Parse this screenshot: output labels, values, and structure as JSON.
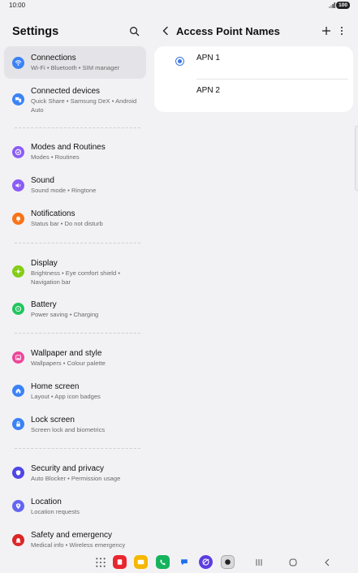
{
  "status_bar": {
    "time": "10:00",
    "battery": "100"
  },
  "left_panel": {
    "title": "Settings",
    "items": [
      {
        "title": "Connections",
        "subtitle": "Wi-Fi  •  Bluetooth  •  SIM manager",
        "icon": "wifi-icon",
        "color": "#3b82f6"
      },
      {
        "title": "Connected devices",
        "subtitle": "Quick Share  •  Samsung DeX  •  Android Auto",
        "icon": "devices-icon",
        "color": "#3b82f6"
      },
      {
        "title": "Modes and Routines",
        "subtitle": "Modes  •  Routines",
        "icon": "routines-icon",
        "color": "#8b5cf6"
      },
      {
        "title": "Sound",
        "subtitle": "Sound mode  •  Ringtone",
        "icon": "speaker-icon",
        "color": "#8b5cf6"
      },
      {
        "title": "Notifications",
        "subtitle": "Status bar  •  Do not disturb",
        "icon": "bell-icon",
        "color": "#f97316"
      },
      {
        "title": "Display",
        "subtitle": "Brightness  •  Eye comfort shield  •  Navigation bar",
        "icon": "sun-icon",
        "color": "#84cc16"
      },
      {
        "title": "Battery",
        "subtitle": "Power saving  •  Charging",
        "icon": "battery-icon",
        "color": "#22c55e"
      },
      {
        "title": "Wallpaper and style",
        "subtitle": "Wallpapers  •  Colour palette",
        "icon": "wallpaper-icon",
        "color": "#ec4899"
      },
      {
        "title": "Home screen",
        "subtitle": "Layout  •  App icon badges",
        "icon": "home-icon",
        "color": "#3b82f6"
      },
      {
        "title": "Lock screen",
        "subtitle": "Screen lock and biometrics",
        "icon": "lock-icon",
        "color": "#3b82f6"
      },
      {
        "title": "Security and privacy",
        "subtitle": "Auto Blocker  •  Permission usage",
        "icon": "shield-icon",
        "color": "#4f46e5"
      },
      {
        "title": "Location",
        "subtitle": "Location requests",
        "icon": "location-icon",
        "color": "#6366f1"
      },
      {
        "title": "Safety and emergency",
        "subtitle": "Medical info  •  Wireless emergency",
        "icon": "emergency-icon",
        "color": "#dc2626"
      }
    ]
  },
  "right_panel": {
    "title": "Access Point Names",
    "apns": [
      {
        "label": "APN 1",
        "selected": true
      },
      {
        "label": "APN 2",
        "selected": false
      }
    ]
  },
  "taskbar": {
    "apps": [
      "apps-grid-icon",
      "red-app-icon",
      "messages-folder-icon",
      "phone-icon",
      "chat-icon",
      "internet-icon",
      "camera-icon"
    ],
    "nav": [
      "recents-icon",
      "home-nav-icon",
      "back-nav-icon"
    ]
  }
}
